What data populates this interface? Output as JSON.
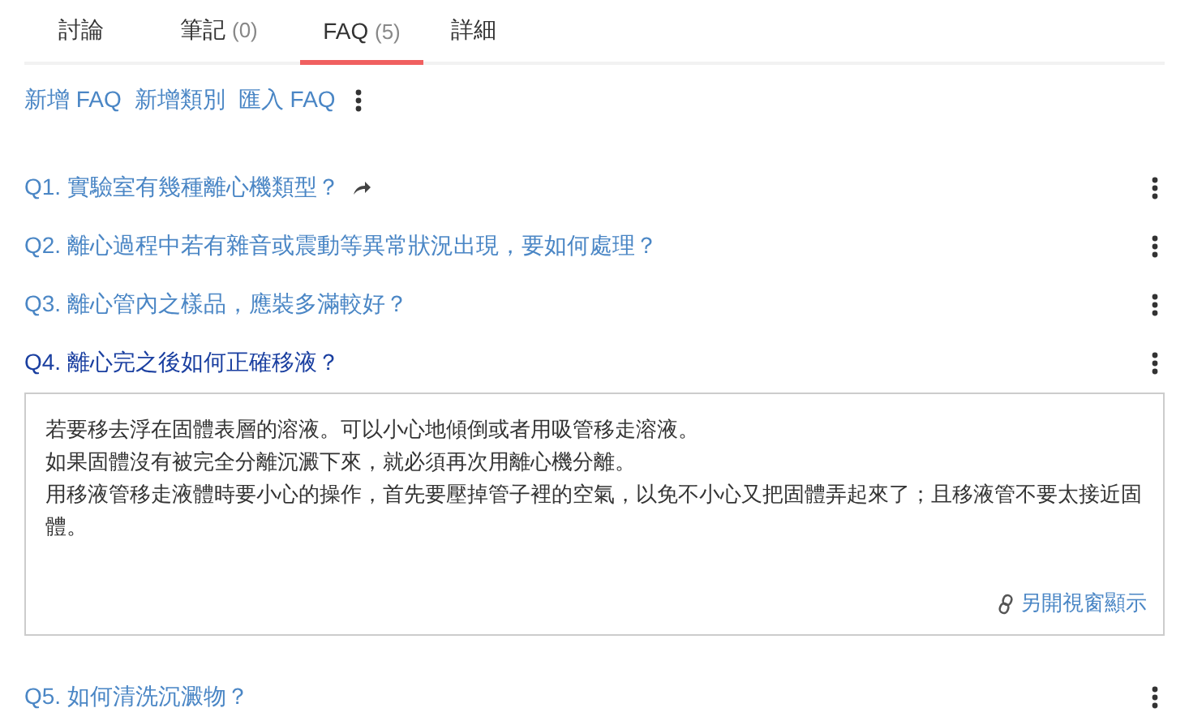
{
  "tabs": [
    {
      "label": "討論",
      "selected": false
    },
    {
      "label": "筆記",
      "count": "(0)",
      "selected": false
    },
    {
      "label": "FAQ",
      "count": "(5)",
      "selected": true
    },
    {
      "label": "詳細",
      "selected": false
    }
  ],
  "actions": [
    "新增 FAQ",
    "新增類別",
    "匯入 FAQ"
  ],
  "faqs": [
    {
      "question": "Q1. 實驗室有幾種離心機類型？",
      "shared": true,
      "expanded": false
    },
    {
      "question": "Q2. 離心過程中若有雜音或震動等異常狀況出現，要如何處理？",
      "shared": false,
      "expanded": false
    },
    {
      "question": "Q3. 離心管內之樣品，應裝多滿較好？",
      "shared": false,
      "expanded": false
    },
    {
      "question": "Q4. 離心完之後如何正確移液？",
      "shared": false,
      "expanded": true,
      "answer": [
        "若要移去浮在固體表層的溶液。可以小心地傾倒或者用吸管移走溶液。",
        "如果固體沒有被完全分離沉澱下來，就必須再次用離心機分離。",
        "用移液管移走液體時要小心的操作，首先要壓掉管子裡的空氣，以免不小心又把固體弄起來了；且移液管不要太接近固體。"
      ],
      "open_link": "另開視窗顯示"
    },
    {
      "question": "Q5. 如何清洗沉澱物？",
      "shared": false,
      "expanded": false
    }
  ]
}
